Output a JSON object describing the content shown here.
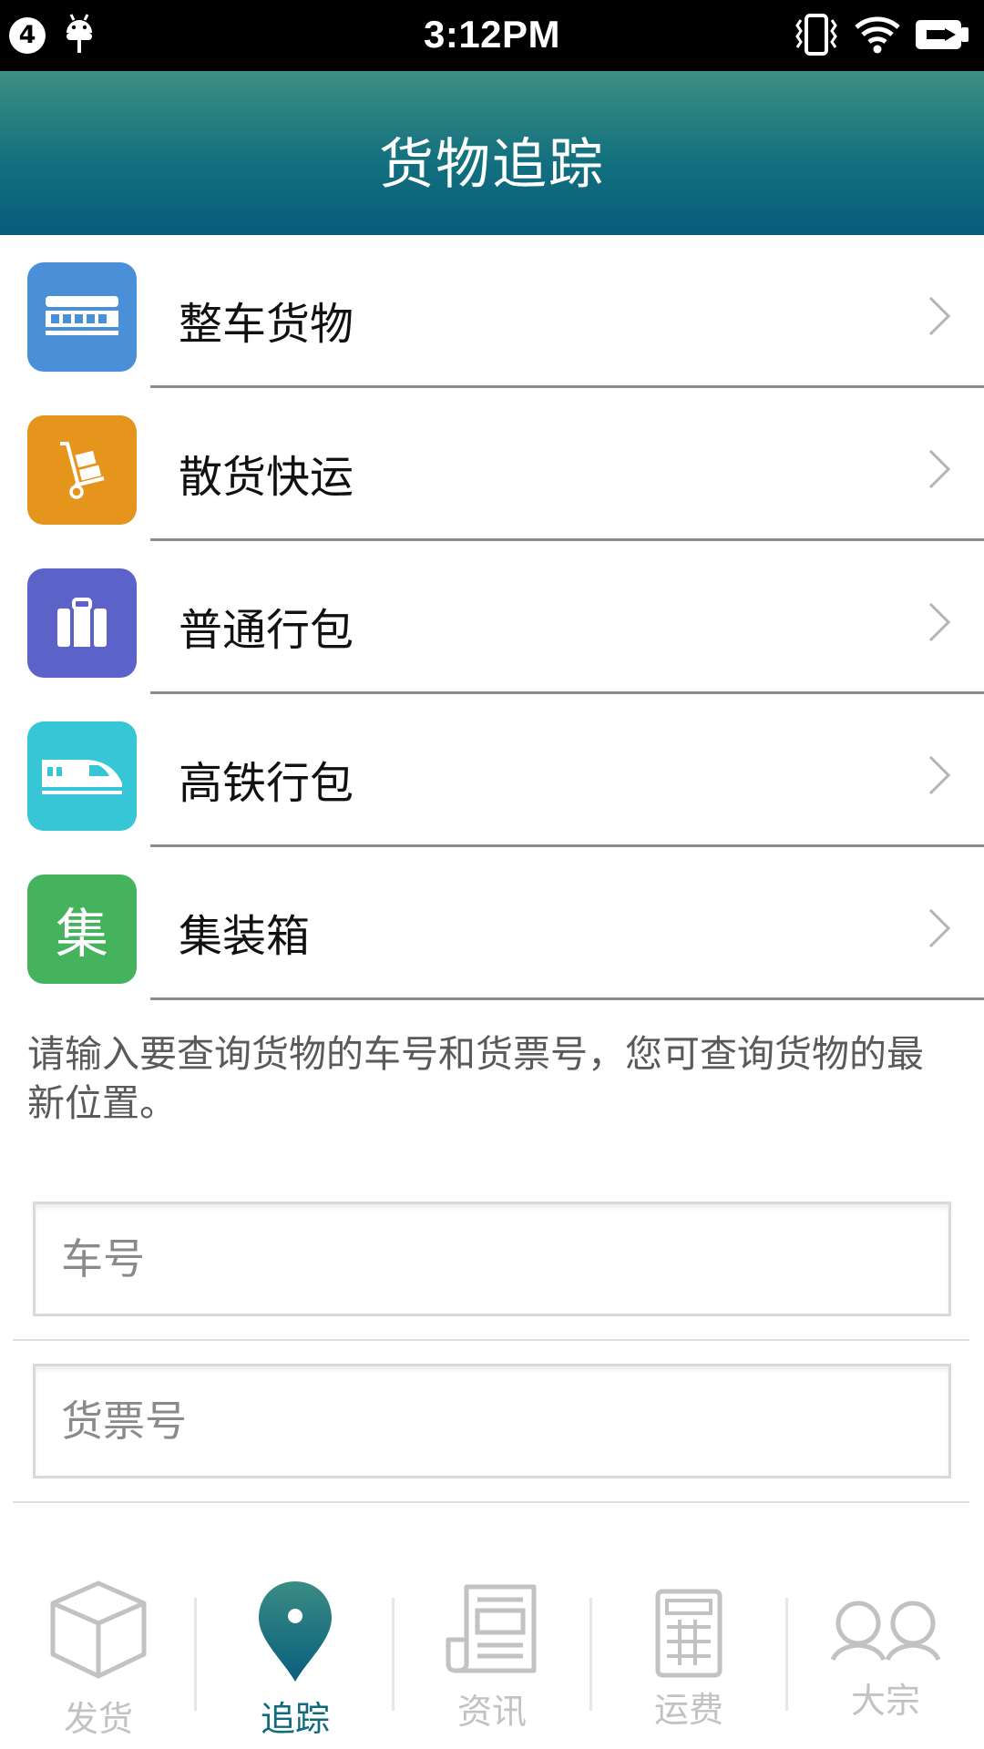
{
  "status_bar": {
    "notification_count": "4",
    "time": "3:12PM"
  },
  "app_bar": {
    "title": "货物追踪"
  },
  "menu": [
    {
      "label": "整车货物",
      "icon": "train-car-icon",
      "color": "#4a90d9"
    },
    {
      "label": "散货快运",
      "icon": "hand-truck-icon",
      "color": "#e5951c"
    },
    {
      "label": "普通行包",
      "icon": "luggage-icon",
      "color": "#5b63c9"
    },
    {
      "label": "高铁行包",
      "icon": "high-speed-train-icon",
      "color": "#36c6d6"
    },
    {
      "label": "集装箱",
      "icon": "container-icon",
      "icon_text": "集",
      "color": "#45b25d"
    }
  ],
  "hint": "请输入要查询货物的车号和货票号，您可查询货物的最新位置。",
  "form": {
    "car_number_placeholder": "车号",
    "waybill_placeholder": "货票号"
  },
  "tabs": [
    {
      "label": "发货",
      "icon": "box-icon",
      "active": false
    },
    {
      "label": "追踪",
      "icon": "location-pin-icon",
      "active": true
    },
    {
      "label": "资讯",
      "icon": "newspaper-icon",
      "active": false
    },
    {
      "label": "运费",
      "icon": "calculator-icon",
      "active": false
    },
    {
      "label": "大宗",
      "icon": "users-icon",
      "active": false
    }
  ],
  "colors": {
    "accent": "#0e6b7c",
    "inactive_tab": "#c2c2c2"
  }
}
